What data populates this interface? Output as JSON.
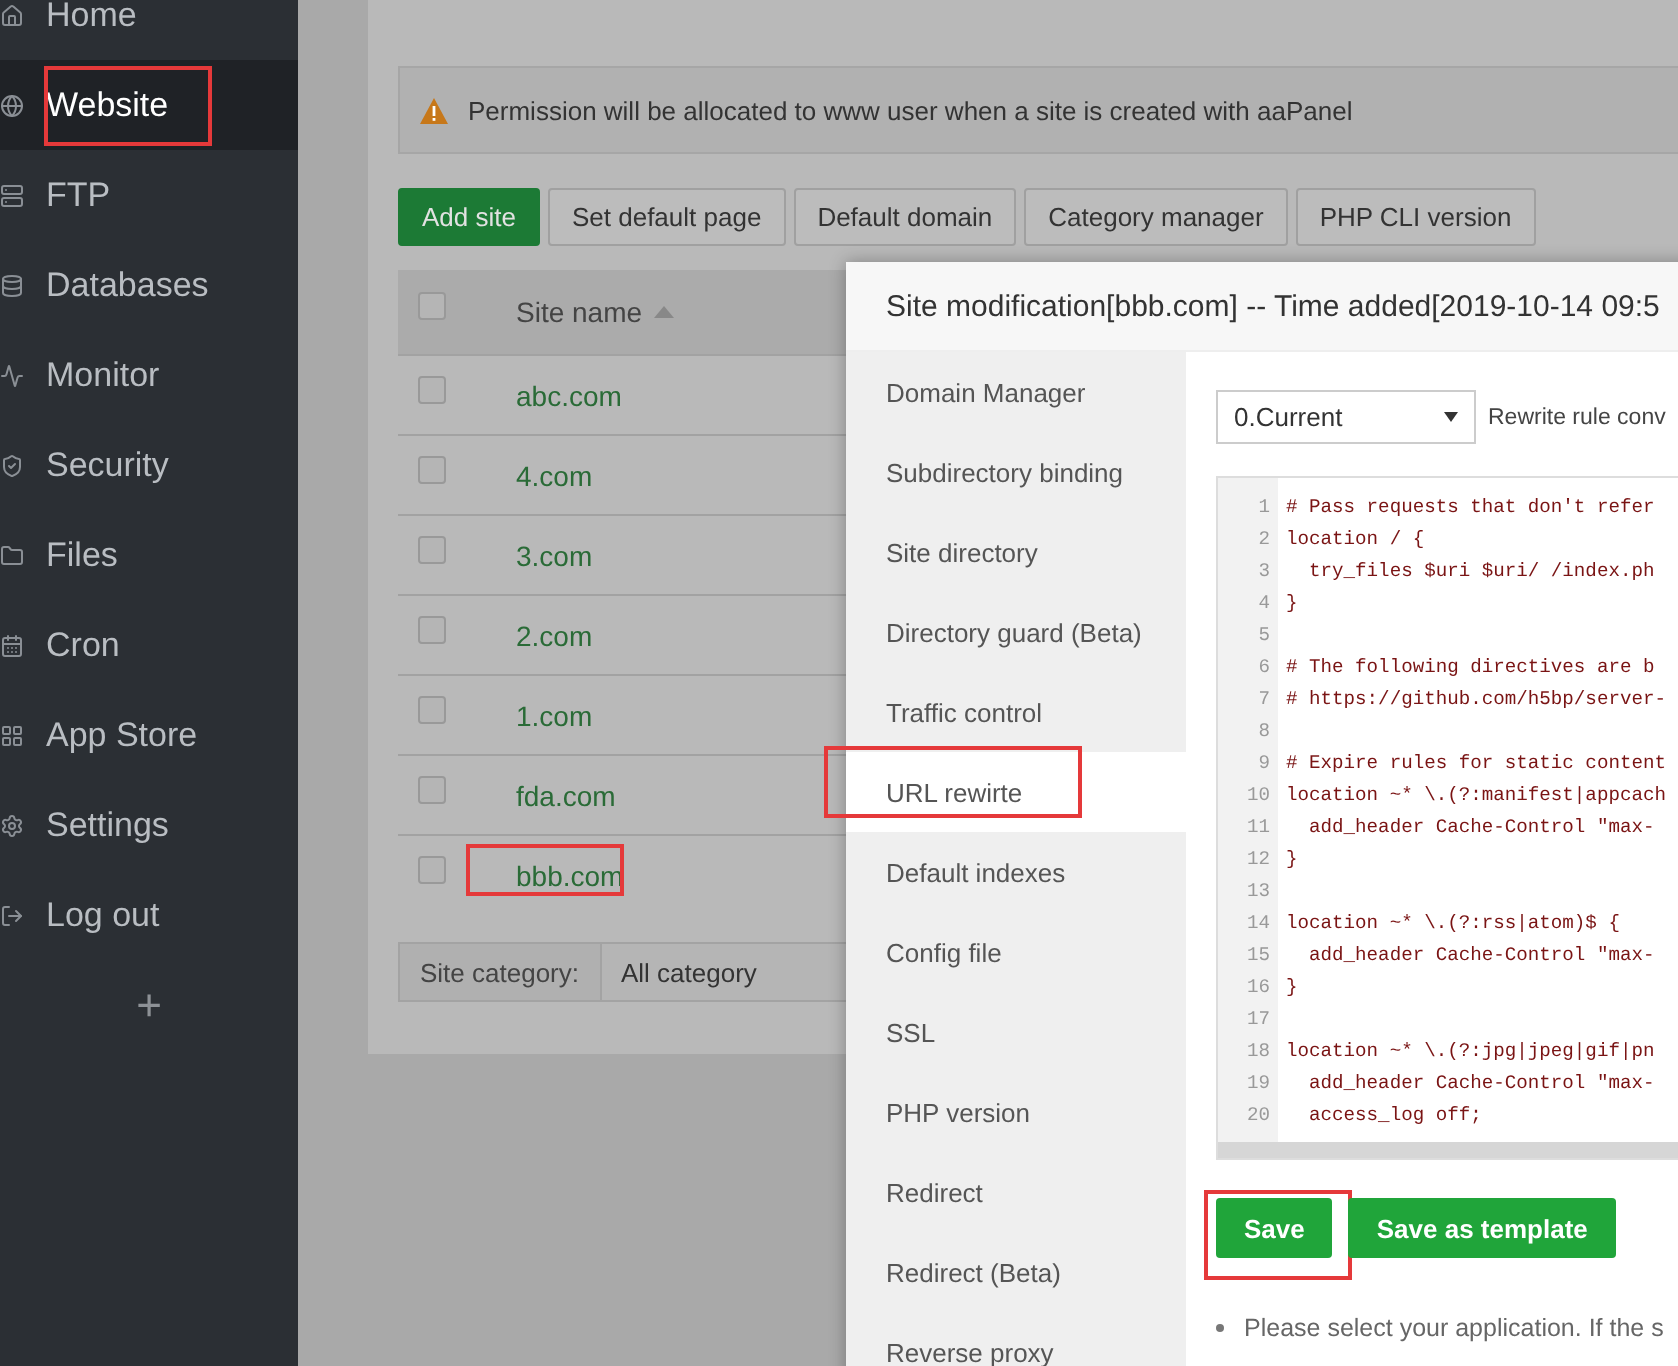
{
  "sidebar": {
    "items": [
      {
        "label": "Home",
        "selected": false,
        "highlighted": false
      },
      {
        "label": "Website",
        "selected": true,
        "highlighted": true
      },
      {
        "label": "FTP",
        "selected": false,
        "highlighted": false
      },
      {
        "label": "Databases",
        "selected": false,
        "highlighted": false
      },
      {
        "label": "Monitor",
        "selected": false,
        "highlighted": false
      },
      {
        "label": "Security",
        "selected": false,
        "highlighted": false
      },
      {
        "label": "Files",
        "selected": false,
        "highlighted": false
      },
      {
        "label": "Cron",
        "selected": false,
        "highlighted": false
      },
      {
        "label": "App Store",
        "selected": false,
        "highlighted": false
      },
      {
        "label": "Settings",
        "selected": false,
        "highlighted": false
      },
      {
        "label": "Log out",
        "selected": false,
        "highlighted": false
      }
    ],
    "add_label": "+"
  },
  "notice": "Permission will be allocated to www user when a site is created with aaPanel",
  "toolbar": [
    {
      "label": "Add site",
      "kind": "primary"
    },
    {
      "label": "Set default page",
      "kind": "default"
    },
    {
      "label": "Default domain",
      "kind": "default"
    },
    {
      "label": "Category manager",
      "kind": "default"
    },
    {
      "label": "PHP CLI version",
      "kind": "default"
    }
  ],
  "table": {
    "select_all_checked": false,
    "columns": [
      "Site name"
    ],
    "rows": [
      {
        "site_name": "abc.com",
        "checked": false,
        "highlighted": false
      },
      {
        "site_name": "4.com",
        "checked": false,
        "highlighted": false
      },
      {
        "site_name": "3.com",
        "checked": false,
        "highlighted": false
      },
      {
        "site_name": "2.com",
        "checked": false,
        "highlighted": false
      },
      {
        "site_name": "1.com",
        "checked": false,
        "highlighted": false
      },
      {
        "site_name": "fda.com",
        "checked": false,
        "highlighted": false
      },
      {
        "site_name": "bbb.com",
        "checked": false,
        "highlighted": true
      }
    ]
  },
  "category_filter": {
    "label": "Site category:",
    "value": "All category"
  },
  "dialog": {
    "title": "Site modification[bbb.com] -- Time added[2019-10-14 09:5",
    "tabs": [
      {
        "label": "Domain Manager",
        "selected": false,
        "highlighted": false
      },
      {
        "label": "Subdirectory binding",
        "selected": false,
        "highlighted": false
      },
      {
        "label": "Site directory",
        "selected": false,
        "highlighted": false
      },
      {
        "label": "Directory guard (Beta)",
        "selected": false,
        "highlighted": false
      },
      {
        "label": "Traffic control",
        "selected": false,
        "highlighted": false
      },
      {
        "label": "URL rewirte",
        "selected": true,
        "highlighted": true
      },
      {
        "label": "Default indexes",
        "selected": false,
        "highlighted": false
      },
      {
        "label": "Config file",
        "selected": false,
        "highlighted": false
      },
      {
        "label": "SSL",
        "selected": false,
        "highlighted": false
      },
      {
        "label": "PHP version",
        "selected": false,
        "highlighted": false
      },
      {
        "label": "Redirect",
        "selected": false,
        "highlighted": false
      },
      {
        "label": "Redirect (Beta)",
        "selected": false,
        "highlighted": false
      },
      {
        "label": "Reverse proxy",
        "selected": false,
        "highlighted": false
      }
    ],
    "rewrite": {
      "template": "0.Current",
      "label": "Rewrite rule conv",
      "lines": [
        {
          "number": "1",
          "code": "# Pass requests that don't refer"
        },
        {
          "number": "2",
          "code": "location / {"
        },
        {
          "number": "3",
          "code": "  try_files $uri $uri/ /index.ph"
        },
        {
          "number": "4",
          "code": "}"
        },
        {
          "number": "5"
        },
        {
          "number": "6",
          "code": "# The following directives are b"
        },
        {
          "number": "7",
          "code": "# https://github.com/h5bp/server-"
        },
        {
          "number": "8"
        },
        {
          "number": "9",
          "code": "# Expire rules for static content"
        },
        {
          "number": "10",
          "code": "location ~* \\.(?:manifest|appcach"
        },
        {
          "number": "11",
          "code": "  add_header Cache-Control \"max-"
        },
        {
          "number": "12",
          "code": "}"
        },
        {
          "number": "13"
        },
        {
          "number": "14",
          "code": "location ~* \\.(?:rss|atom)$ {"
        },
        {
          "number": "15",
          "code": "  add_header Cache-Control \"max-"
        },
        {
          "number": "16",
          "code": "}"
        },
        {
          "number": "17"
        },
        {
          "number": "18",
          "code": "location ~* \\.(?:jpg|jpeg|gif|pn"
        },
        {
          "number": "19",
          "code": "  add_header Cache-Control \"max-"
        },
        {
          "number": "20",
          "code": "  access_log off;"
        }
      ],
      "buttons": [
        {
          "label": "Save",
          "kind": "primary",
          "highlighted": true
        },
        {
          "label": "Save as template",
          "kind": "primary"
        }
      ],
      "notes": [
        "Please select your application. If the s"
      ]
    }
  }
}
